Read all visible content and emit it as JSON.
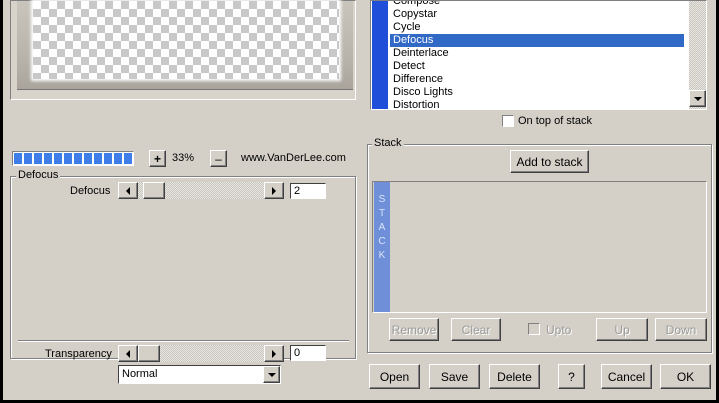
{
  "filter_list": {
    "items": [
      "Compose",
      "Copystar",
      "Cycle",
      "Defocus",
      "Deinterlace",
      "Detect",
      "Difference",
      "Disco Lights",
      "Distortion"
    ],
    "selected_index": 3
  },
  "on_top_of_stack": {
    "label": "On top of stack",
    "checked": false
  },
  "zoom": {
    "plus": "+",
    "minus": "–",
    "value": "33%"
  },
  "progress": {
    "segments_filled": 12
  },
  "website": "www.VanDerLee.com",
  "defocus_group": {
    "title": "Defocus",
    "slider_label": "Defocus",
    "value": "2"
  },
  "transparency": {
    "label": "Transparency",
    "value": "0",
    "blend_mode": "Normal"
  },
  "stack": {
    "title": "Stack",
    "add_button": "Add to stack",
    "side_label": "STACK",
    "remove": "Remove",
    "clear": "Clear",
    "upto": "Upto",
    "up": "Up",
    "down": "Down"
  },
  "bottom_buttons": {
    "open": "Open",
    "save": "Save",
    "delete": "Delete",
    "help": "?",
    "cancel": "Cancel",
    "ok": "OK"
  },
  "colors": {
    "selection": "#3169c6",
    "list_stripe": "#1f4fd8",
    "stack_bar": "#6f8fd8",
    "progress": "#3f7ee8"
  }
}
